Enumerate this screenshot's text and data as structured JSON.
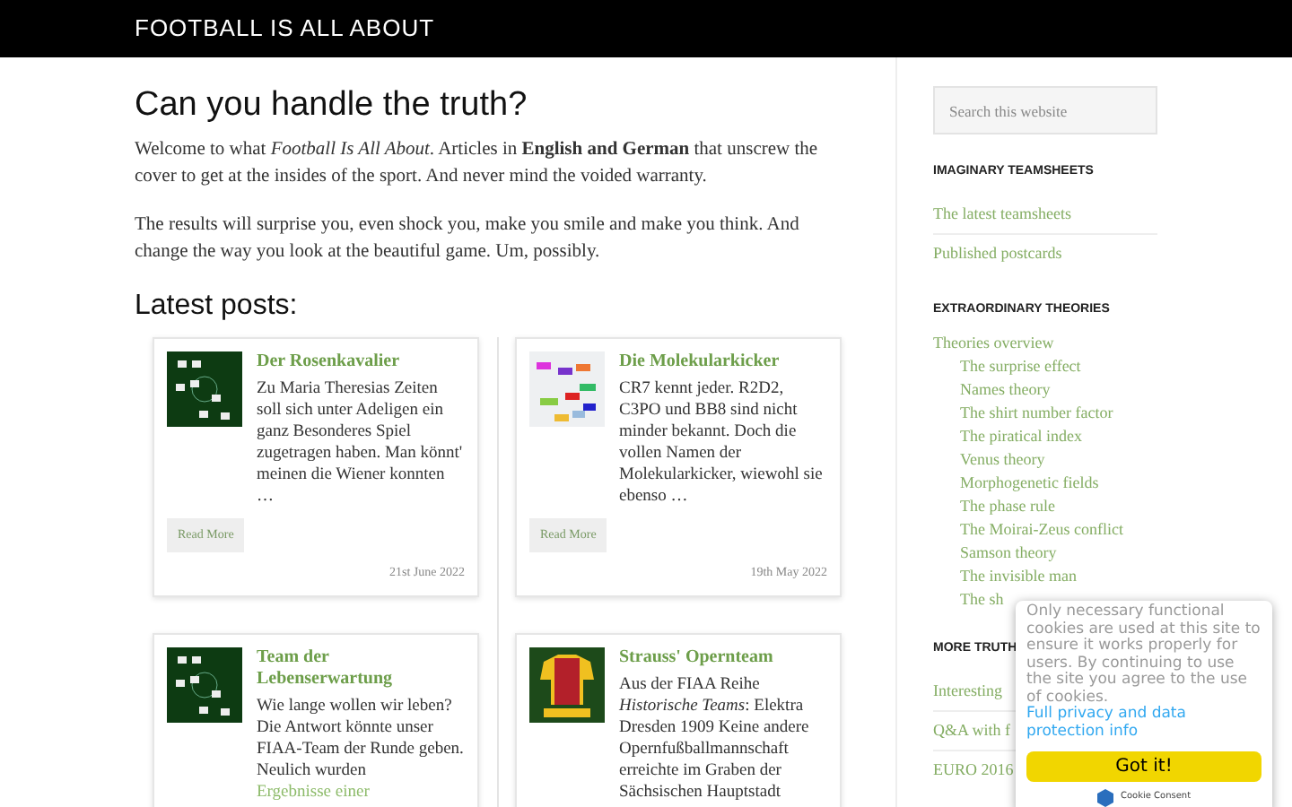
{
  "header": {
    "site_title": "FOOTBALL IS ALL ABOUT"
  },
  "main": {
    "title": "Can you handle the truth?",
    "paragraphs": [
      "Welcome to what *Football Is All About*. Articles in **English and German** that unscrew the cover to get at the insides of the sport. And never mind the voided warranty.",
      "The results will surprise you, even shock you, make you smile and make you think. And change the way you look at the beautiful game. Um, possibly."
    ],
    "latest_title": "Latest posts:",
    "posts": [
      {
        "kind": "teamsheet",
        "title": "Der Rosenkavalier",
        "excerpt": "Zu Maria Theresias Zeiten soll sich unter Adeligen ein ganz Besonderes Spiel zugetragen haben. Man könnt' meinen die Wiener konnten …",
        "button": "Read More",
        "date": "21st June 2022"
      },
      {
        "kind": "diagram",
        "title": "Die Molekularkicker",
        "excerpt": "CR7 kennt jeder. R2D2, C3PO und BB8 sind nicht minder bekannt. Doch die vollen Namen der Molekularkicker, wiewohl sie ebenso …",
        "button": "Read More",
        "date": "19th May 2022"
      },
      {
        "kind": "teamsheet",
        "title": "Team der Lebenserwartung",
        "excerpt": "Wie lange wollen wir leben? Die Antwort könnte unser FIAA-Team der Runde geben. Neulich wurden",
        "link": "Ergebnisse einer"
      },
      {
        "kind": "shirt",
        "title": "Strauss' Opernteam",
        "excerpt": "Aus der FIAA Reihe *Historische Teams*: Elektra Dresden 1909 Keine andere Opernfußballmannschaft erreichte im Graben der Sächsischen Hauptstadt"
      }
    ]
  },
  "sidebar": {
    "search": {
      "placeholder": "Search this website"
    },
    "sections": [
      {
        "title": "IMAGINARY TEAMSHEETS",
        "items": [
          {
            "label": "The latest teamsheets"
          },
          {
            "label": "Published postcards"
          }
        ]
      },
      {
        "title": "EXTRAORDINARY THEORIES",
        "items": [
          {
            "label": "Theories overview",
            "children": [
              {
                "label": "The surprise effect"
              },
              {
                "label": "Names theory"
              },
              {
                "label": "The shirt number factor"
              },
              {
                "label": "The piratical index"
              },
              {
                "label": "Venus theory"
              },
              {
                "label": "Morphogenetic fields"
              },
              {
                "label": "The phase rule"
              },
              {
                "label": "The Moirai-Zeus conflict"
              },
              {
                "label": "Samson theory"
              },
              {
                "label": "The invisible man"
              },
              {
                "label": "The sh"
              }
            ]
          }
        ]
      },
      {
        "title": "MORE TRUTH",
        "items": [
          {
            "label": "Interesting"
          },
          {
            "label": "Q&A with f"
          },
          {
            "label": "EURO 2016"
          }
        ]
      }
    ]
  },
  "cookie_notice": {
    "message": "Only necessary functional cookies are used at this site to ensure it works properly for users. By continuing to use the site you agree to the use of cookies.",
    "link": "Full privacy and data protection info",
    "button": "Got it!",
    "branding": "Cookie Consent"
  }
}
